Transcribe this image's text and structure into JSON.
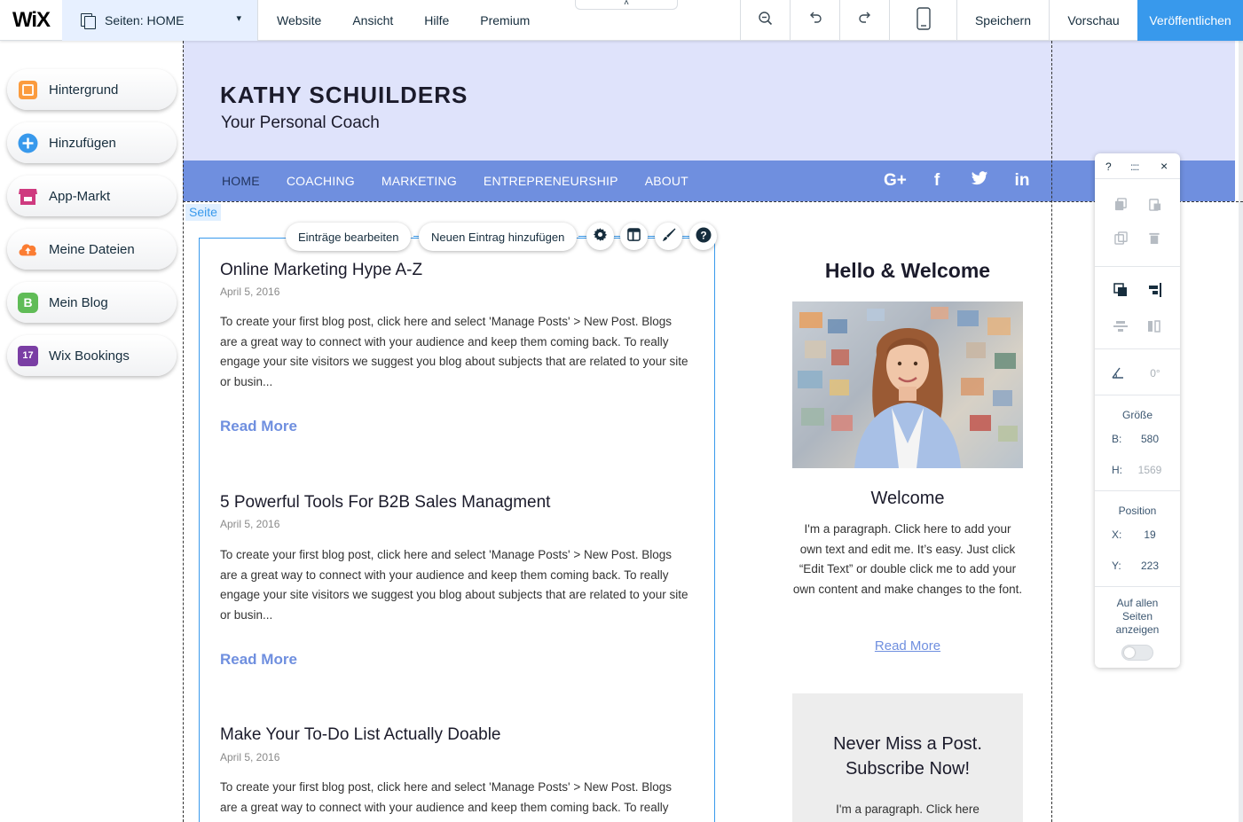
{
  "topbar": {
    "logo": "WiX",
    "pages_label": "Seiten: HOME",
    "menu": [
      "Website",
      "Ansicht",
      "Hilfe",
      "Premium"
    ],
    "save": "Speichern",
    "preview": "Vorschau",
    "publish": "Veröffentlichen",
    "collapse_glyph": "˄"
  },
  "left_panel": [
    {
      "label": "Hintergrund",
      "color": "#fb9b3e"
    },
    {
      "label": "Hinzufügen",
      "color": "#3899ec"
    },
    {
      "label": "App-Markt",
      "color": "#cf3a7f"
    },
    {
      "label": "Meine Dateien",
      "color": "#fb7d33"
    },
    {
      "label": "Mein Blog",
      "color": "#60bc57",
      "glyph": "B"
    },
    {
      "label": "Wix Bookings",
      "color": "#7a3ea4",
      "glyph": "17"
    }
  ],
  "site": {
    "title": "KATHY SCHUILDERS",
    "subtitle": "Your Personal Coach",
    "nav": [
      "HOME",
      "COACHING",
      "MARKETING",
      "ENTREPRENEURSHIP",
      "ABOUT"
    ],
    "social": [
      "G+",
      "f",
      "🐦",
      "in"
    ],
    "header_color": "#dfe3fb",
    "nav_color": "#6f8fdf"
  },
  "page_tag": "Seite",
  "blog_toolbar": {
    "edit_entries": "Einträge bearbeiten",
    "add_entry": "Neuen Eintrag hinzufügen"
  },
  "posts": [
    {
      "title": "Online Marketing Hype A-Z",
      "date": "April 5, 2016",
      "text": "To create your first blog post, click here and select 'Manage Posts' > New Post. Blogs are a great way to connect with your audience and keep them coming back. To really engage your site visitors we suggest you blog about subjects that are related to your site or busin...",
      "read_more": "Read More"
    },
    {
      "title": "5 Powerful Tools For B2B Sales Managment",
      "date": "April 5, 2016",
      "text": "To create your first blog post, click here and select 'Manage Posts' > New Post. Blogs are a great way to connect with your audience and keep them coming back. To really engage your site visitors we suggest you blog about subjects that are related to your site or busin...",
      "read_more": "Read More"
    },
    {
      "title": "Make Your To-Do List Actually Doable",
      "date": "April 5, 2016",
      "text": "To create your first blog post, click here and select 'Manage Posts' > New Post. Blogs are a great way to connect with your audience and keep them coming back. To really",
      "read_more": ""
    }
  ],
  "sidebar": {
    "heading": "Hello & Welcome",
    "subheading": "Welcome",
    "paragraph": "I'm a paragraph. Click here to add your own text and edit me. It’s easy. Just click “Edit Text” or double click me to add your own content and make changes to the font.",
    "read_more": "Read More",
    "subscribe_title_1": "Never Miss a Post.",
    "subscribe_title_2": "Subscribe Now!",
    "subscribe_text": "I'm a paragraph. Click here"
  },
  "inspector": {
    "help": "?",
    "drag": "::::",
    "close": "×",
    "rotation": "0°",
    "size_label": "Größe",
    "width_key": "B:",
    "width_val": "580",
    "height_key": "H:",
    "height_val": "1569",
    "position_label": "Position",
    "x_key": "X:",
    "x_val": "19",
    "y_key": "Y:",
    "y_val": "223",
    "show_all_1": "Auf allen",
    "show_all_2": "Seiten",
    "show_all_3": "anzeigen",
    "toggle_on": false
  }
}
